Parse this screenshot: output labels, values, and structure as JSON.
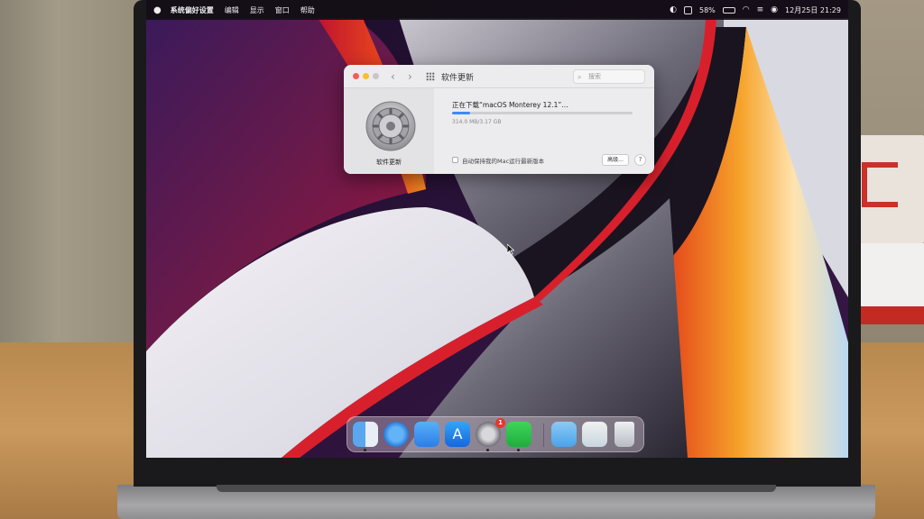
{
  "menubar": {
    "apple_icon": "apple-logo",
    "app_name": "系统偏好设置",
    "menus": [
      "编辑",
      "显示",
      "窗口",
      "帮助"
    ],
    "battery": "58%",
    "datetime": "12月25日  21:29"
  },
  "window": {
    "title": "软件更新",
    "search_placeholder": "搜索",
    "pane_label": "软件更新",
    "download_title": "正在下载“macOS Monterey 12.1”…",
    "download_size": "314.0 MB/3.17 GB",
    "download_progress": 0.1,
    "auto_update_label": "自动保持我的Mac运行最新版本",
    "advanced_button": "高级...",
    "help_button": "?"
  },
  "dock": {
    "items": [
      "finder-icon",
      "safari-icon",
      "mail-icon",
      "app-store-icon",
      "system-preferences-icon",
      "wechat-icon",
      "downloads-folder-icon",
      "documents-stack-icon",
      "trash-icon"
    ],
    "preferences_badge": "1"
  },
  "colors": {
    "accent": "#3d8af7",
    "badge": "#e8352c",
    "window_bg": "#ececee"
  }
}
